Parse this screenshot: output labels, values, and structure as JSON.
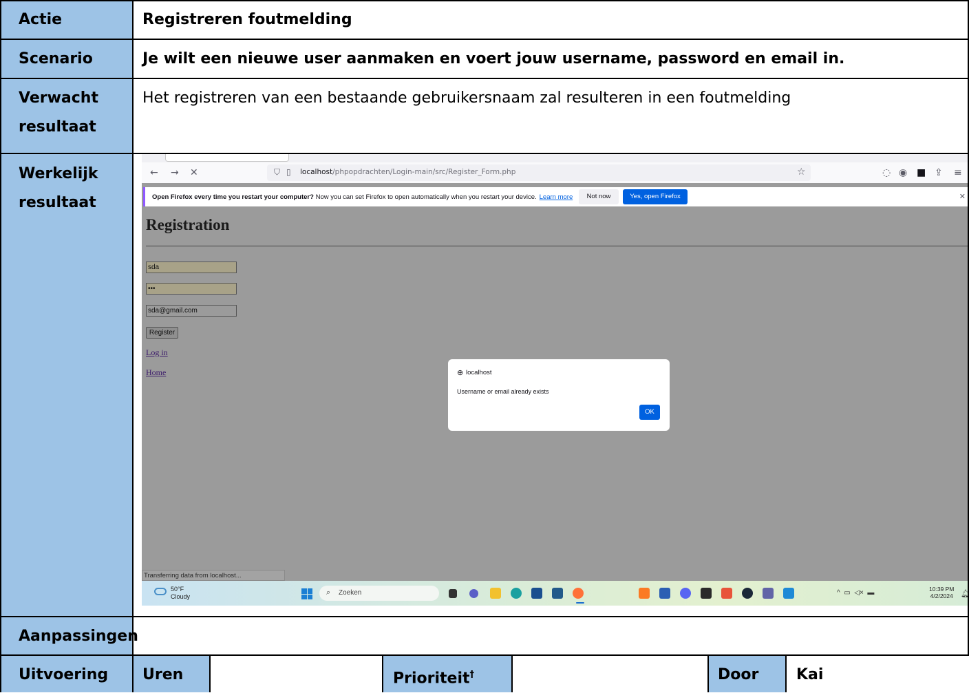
{
  "rows": {
    "actie": {
      "label": "Actie",
      "value": "Registreren foutmelding"
    },
    "scenario": {
      "label": "Scenario",
      "value": "Je wilt een nieuwe user aanmaken en voert jouw username, password en email in."
    },
    "verwacht": {
      "label_line1": "Verwacht",
      "label_line2": "resultaat",
      "value": "Het registreren van een bestaande gebruikersnaam zal resulteren in een foutmelding"
    },
    "werkelijk": {
      "label_line1": "Werkelijk",
      "label_line2": "resultaat"
    },
    "aanpassingen": {
      "label": "Aanpassingen",
      "value": ""
    },
    "uitvoering": {
      "label": "Uitvoering",
      "uren_label": "Uren",
      "uren_value": "",
      "prioriteit_label": "Prioriteit",
      "prioriteit_mark": "†",
      "prioriteit_value": "",
      "door_label": "Door",
      "door_value": "Kai"
    }
  },
  "screenshot": {
    "url_host": "localhost",
    "url_path": "/phpopdrachten/Login-main/src/Register_Form.php",
    "notification": {
      "bold": "Open Firefox every time you restart your computer?",
      "text": "Now you can set Firefox to open automatically when you restart your device.",
      "learn_more": "Learn more",
      "not_now": "Not now",
      "yes_open": "Yes, open Firefox"
    },
    "page": {
      "title": "Registration",
      "username_value": "sda",
      "password_value": "•••",
      "email_value": "sda@gmail.com",
      "register_button": "Register",
      "login_link": "Log in",
      "home_link": "Home"
    },
    "dialog": {
      "host": "localhost",
      "message": "Username or email already exists",
      "ok": "OK"
    },
    "status_bar": "Transferring data from localhost...",
    "taskbar": {
      "temperature": "50°F",
      "condition": "Cloudy",
      "search_placeholder": "Zoeken",
      "time": "10:39 PM",
      "date": "4/2/2024"
    }
  },
  "colors": {
    "label_bg": "#9dc3e6",
    "accent": "#0061e0",
    "firefox_accent": "#9059ff"
  }
}
